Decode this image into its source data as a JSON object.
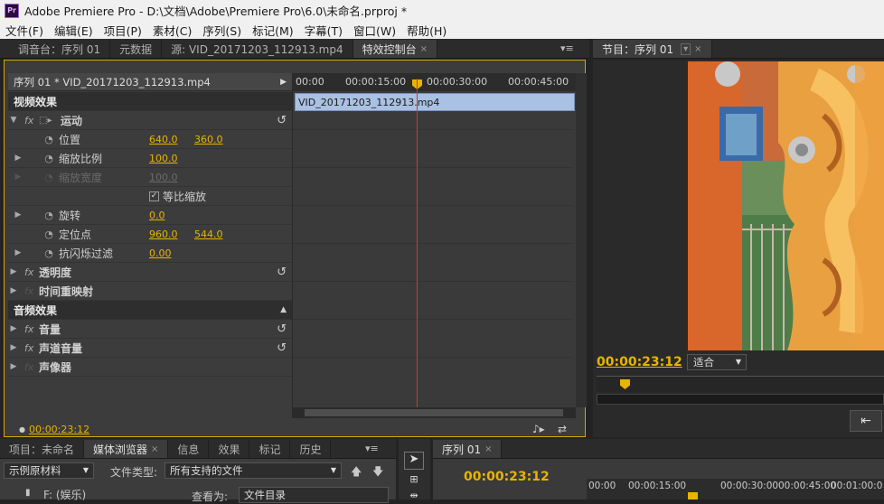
{
  "window": {
    "title": "Adobe Premiere Pro - D:\\文档\\Adobe\\Premiere Pro\\6.0\\未命名.prproj *",
    "logo": "Pr"
  },
  "menu": [
    "文件(F)",
    "编辑(E)",
    "项目(P)",
    "素材(C)",
    "序列(S)",
    "标记(M)",
    "字幕(T)",
    "窗口(W)",
    "帮助(H)"
  ],
  "top_tabs": [
    "调音台：序列 01",
    "元数据",
    "源: VID_20171203_112913.mp4",
    "特效控制台"
  ],
  "program_tab": "节目：序列 01",
  "effect_controls": {
    "sequence_header": "序列 01 * VID_20171203_112913.mp4",
    "video_effects": "视频效果",
    "motion": "运动",
    "position": {
      "label": "位置",
      "x": "640.0",
      "y": "360.0"
    },
    "scale": {
      "label": "缩放比例",
      "value": "100.0"
    },
    "scale_width": {
      "label": "缩放宽度",
      "value": "100.0"
    },
    "uniform_scale": "等比缩放",
    "rotation": {
      "label": "旋转",
      "value": "0.0"
    },
    "anchor": {
      "label": "定位点",
      "x": "960.0",
      "y": "544.0"
    },
    "anti_flicker": {
      "label": "抗闪烁过滤",
      "value": "0.00"
    },
    "opacity": "透明度",
    "time_remap": "时间重映射",
    "audio_effects": "音频效果",
    "volume": "音量",
    "channel_volume": "声道音量",
    "panner": "声像器",
    "ruler": [
      "00:00",
      "00:00:15:00",
      "00:00:30:00",
      "00:00:45:00"
    ],
    "clip_name": "VID_20171203_112913.mp4",
    "timecode": "00:00:23:12"
  },
  "program": {
    "timecode": "00:00:23:12",
    "fit": "适合"
  },
  "bottom_tabs": [
    "项目：未命名",
    "媒体浏览器",
    "信息",
    "效果",
    "标记",
    "历史"
  ],
  "media_browser": {
    "show": "示例原材料",
    "file_type_label": "文件类型:",
    "file_type_value": "所有支持的文件",
    "drive": "F: (娱乐)",
    "view_label": "查看为:",
    "view_value": "文件目录"
  },
  "timeline": {
    "tab": "序列 01",
    "timecode": "00:00:23:12",
    "ruler": [
      "00:00",
      "00:00:15:00",
      "00:00:30:00",
      "00:00:45:00",
      "00:01:00:0"
    ]
  },
  "colors": {
    "accent": "#e8b400",
    "clip": "#a9c1e2",
    "playhead": "#c83a3a"
  }
}
